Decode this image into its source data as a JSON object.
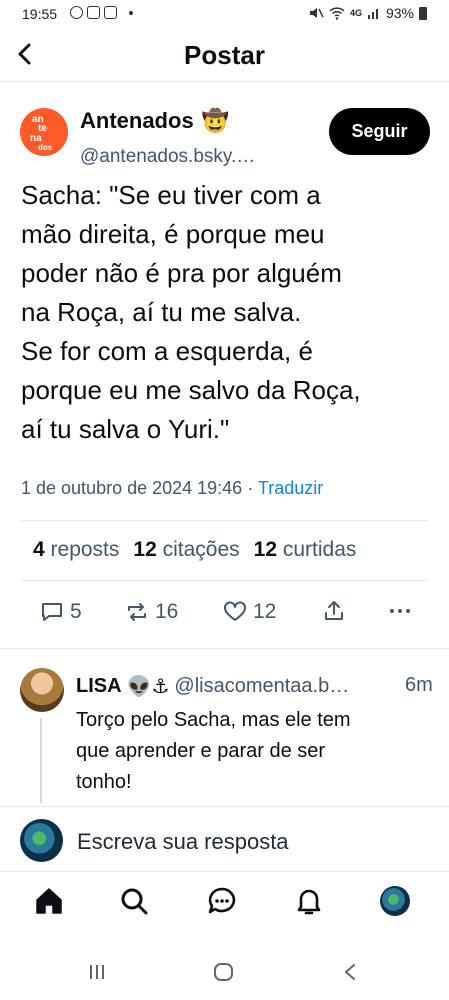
{
  "status_bar": {
    "time": "19:55",
    "battery": "93%",
    "signal_label": "4G"
  },
  "header": {
    "title": "Postar"
  },
  "post": {
    "avatar_text": [
      "an",
      "te",
      "na",
      "dos"
    ],
    "author_name": "Antenados",
    "author_emoji": "🤠",
    "author_handle": "@antenados.bsky.…",
    "follow_label": "Seguir",
    "text_lines": [
      "Sacha: \"Se eu tiver com a",
      "mão direita, é porque meu",
      "poder não é pra por alguém",
      "na Roça, aí tu me salva.",
      "Se for com a esquerda, é",
      "porque eu me salvo da Roça,",
      "aí tu salva o Yuri.\""
    ],
    "date": "1 de outubro de 2024 19:46",
    "separator": "·",
    "translate_label": "Traduzir",
    "stats": {
      "reposts_count": "4",
      "reposts_label": "reposts",
      "quotes_count": "12",
      "quotes_label": "citações",
      "likes_count": "12",
      "likes_label": "curtidas"
    },
    "actions": {
      "replies": "5",
      "reposts": "16",
      "likes": "12"
    }
  },
  "reply": {
    "name": "LISA",
    "emojis": "👽⚓",
    "handle": "@lisacomentaa.b…",
    "time": "6m",
    "text_lines": [
      "Torço pelo Sacha, mas ele tem",
      "que aprender e parar de ser",
      "tonho!"
    ]
  },
  "compose": {
    "placeholder": "Escreva sua resposta"
  },
  "colors": {
    "accent": "#1083fe",
    "muted": "#42576c",
    "text": "#0b0f14",
    "avatar_orange": "#ff5a2a"
  },
  "nav": {
    "items": [
      "home-icon",
      "search-icon",
      "chat-icon",
      "bell-icon",
      "profile-avatar"
    ]
  }
}
